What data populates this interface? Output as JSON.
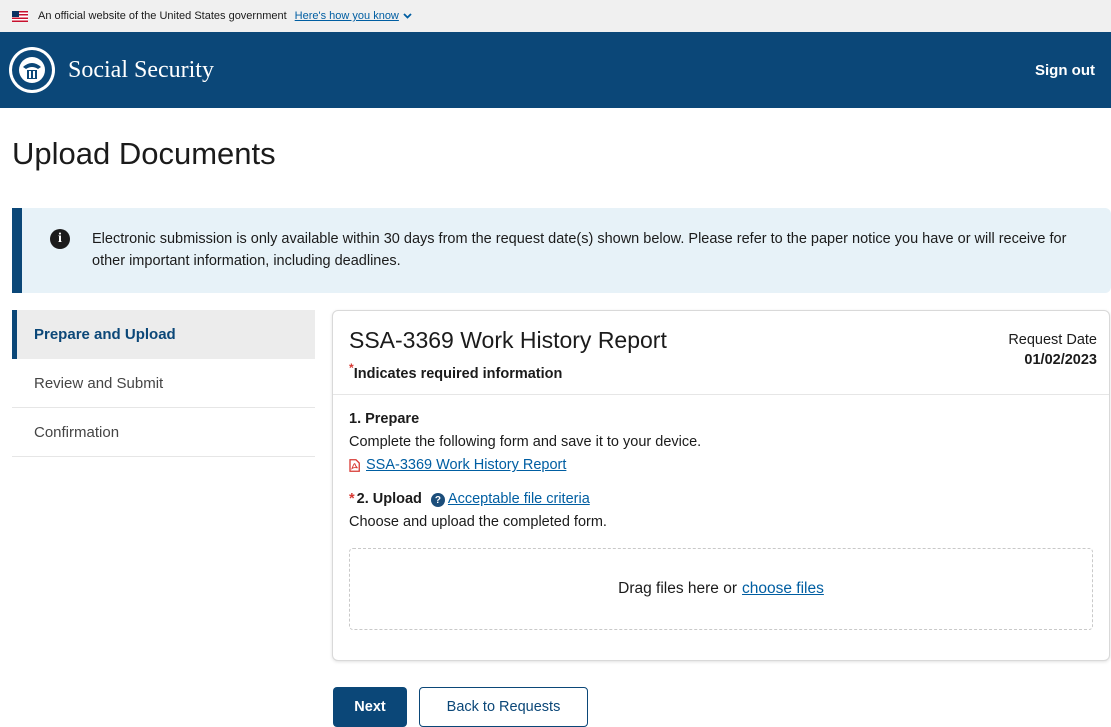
{
  "banner": {
    "text": "An official website of the United States government",
    "link": "Here's how you know"
  },
  "header": {
    "brand": "Social Security",
    "sign_out": "Sign out"
  },
  "page_title": "Upload Documents",
  "alert": {
    "text": "Electronic submission is only available within 30 days from the request date(s) shown below. Please refer to the paper notice you have or will receive for other important information, including deadlines."
  },
  "side_nav": {
    "items": [
      {
        "label": "Prepare and Upload",
        "active": true
      },
      {
        "label": "Review and Submit",
        "active": false
      },
      {
        "label": "Confirmation",
        "active": false
      }
    ]
  },
  "card": {
    "title": "SSA-3369 Work History Report",
    "required_note": "Indicates required information",
    "asterisk": "*",
    "request_date_label": "Request Date",
    "request_date_value": "01/02/2023",
    "prepare": {
      "title": "1. Prepare",
      "description": "Complete the following form and save it to your device.",
      "form_link": "SSA-3369 Work History Report"
    },
    "upload": {
      "title": "2. Upload",
      "criteria_link": "Acceptable file criteria",
      "description": "Choose and upload the completed form.",
      "drop_text": "Drag files here or",
      "choose_link": "choose files"
    }
  },
  "buttons": {
    "next": "Next",
    "back": "Back to Requests"
  },
  "colors": {
    "header_bg": "#0b4778",
    "link": "#005ea2",
    "alert_bg": "#e7f2f8",
    "required": "#d83933"
  }
}
